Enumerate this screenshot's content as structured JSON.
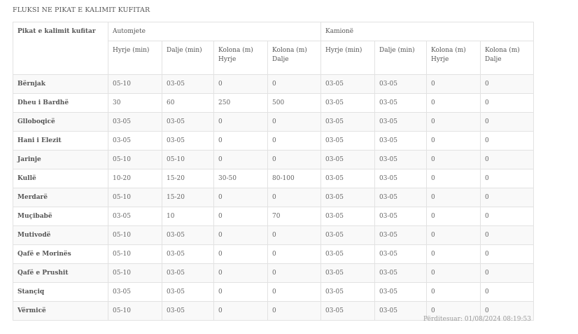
{
  "page": {
    "title": "FLUKSI NE PIKAT E KALIMIT KUFITAR"
  },
  "table": {
    "crossing_header": "Pikat e kalimit kufitar",
    "groups": [
      "Automjete",
      "Kamionë"
    ],
    "subheaders": [
      "Hyrje (min)",
      "Dalje (min)",
      "Kolona (m) Hyrje",
      "Kolona (m) Dalje",
      "Hyrje (min)",
      "Dalje (min)",
      "Kolona (m) Hyrje",
      "Kolona (m) Dalje"
    ],
    "rows": [
      [
        "Bërnjak",
        "05-10",
        "03-05",
        "0",
        "0",
        "03-05",
        "03-05",
        "0",
        "0"
      ],
      [
        "Dheu i Bardhë",
        "30",
        "60",
        "250",
        "500",
        "03-05",
        "03-05",
        "0",
        "0"
      ],
      [
        "Glloboqicë",
        "03-05",
        "03-05",
        "0",
        "0",
        "03-05",
        "03-05",
        "0",
        "0"
      ],
      [
        "Hani i Elezit",
        "03-05",
        "03-05",
        "0",
        "0",
        "03-05",
        "03-05",
        "0",
        "0"
      ],
      [
        "Jarinje",
        "05-10",
        "05-10",
        "0",
        "0",
        "03-05",
        "03-05",
        "0",
        "0"
      ],
      [
        "Kullë",
        "10-20",
        "15-20",
        "30-50",
        "80-100",
        "03-05",
        "03-05",
        "0",
        "0"
      ],
      [
        "Merdarë",
        "05-10",
        "15-20",
        "0",
        "0",
        "03-05",
        "03-05",
        "0",
        "0"
      ],
      [
        "Muçibabë",
        "03-05",
        "10",
        "0",
        "70",
        "03-05",
        "03-05",
        "0",
        "0"
      ],
      [
        "Mutivodë",
        "05-10",
        "03-05",
        "0",
        "0",
        "03-05",
        "03-05",
        "0",
        "0"
      ],
      [
        "Qafë e Morinës",
        "05-10",
        "03-05",
        "0",
        "0",
        "03-05",
        "03-05",
        "0",
        "0"
      ],
      [
        "Qafë e Prushit",
        "05-10",
        "03-05",
        "0",
        "0",
        "03-05",
        "03-05",
        "0",
        "0"
      ],
      [
        "Stançiq",
        "03-05",
        "03-05",
        "0",
        "0",
        "03-05",
        "03-05",
        "0",
        "0"
      ],
      [
        "Vërmicë",
        "05-10",
        "03-05",
        "0",
        "0",
        "03-05",
        "03-05",
        "0",
        "0"
      ]
    ]
  },
  "footer": {
    "updated": "Përditesuar: 01/08/2024 08:19:53"
  }
}
